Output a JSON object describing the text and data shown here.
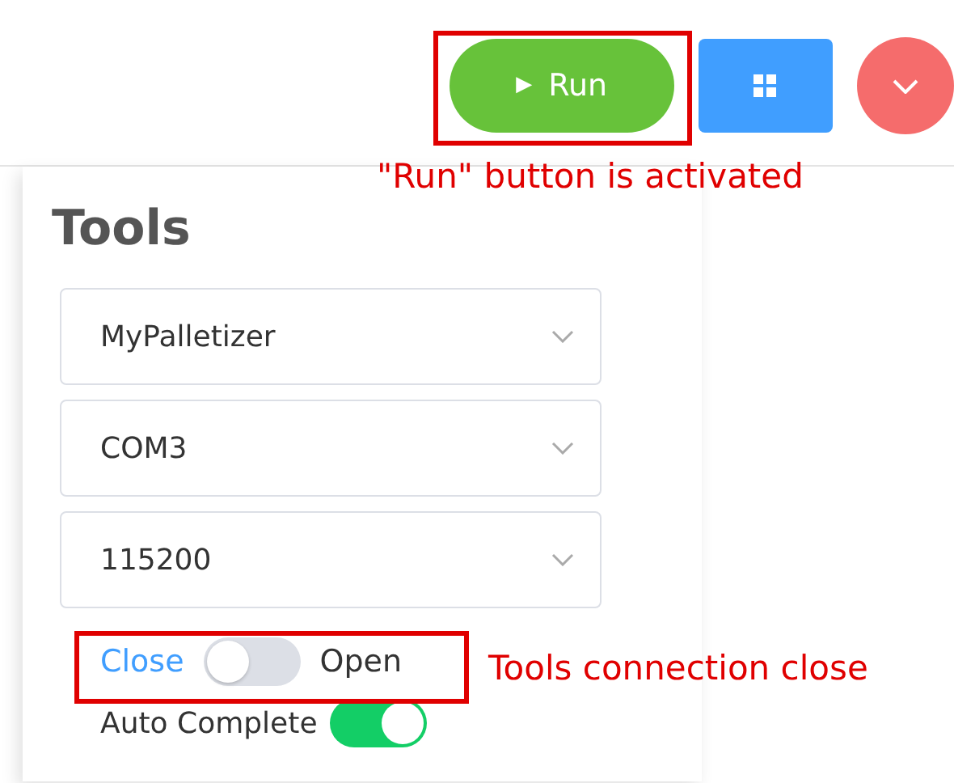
{
  "toolbar": {
    "run_button": {
      "icon": "▶",
      "label": "Run",
      "active": true,
      "annotation": "\"Run\" button is activated"
    }
  },
  "tools": {
    "title": "Tools",
    "selects": [
      {
        "value": "MyPalletizer"
      },
      {
        "value": "COM3"
      },
      {
        "value": "115200"
      }
    ],
    "connection": {
      "off_label": "Close",
      "on_label": "Open",
      "on": false,
      "annotation": "Tools connection close"
    },
    "auto_complete": {
      "label": "Auto Complete",
      "on": true
    }
  }
}
